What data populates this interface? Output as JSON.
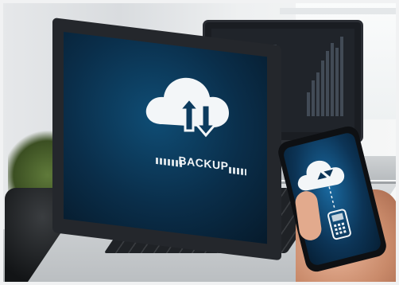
{
  "scene": {
    "laptop_screen_label": "BACKUP",
    "icons": [
      "cloud-upload-download-icon",
      "cloud-sync-icon",
      "phone-device-icon"
    ],
    "colors": {
      "screen_blue": "#0f4d75",
      "phone_blue": "#1a6aa1",
      "icon_white": "#f3f6f8"
    }
  }
}
